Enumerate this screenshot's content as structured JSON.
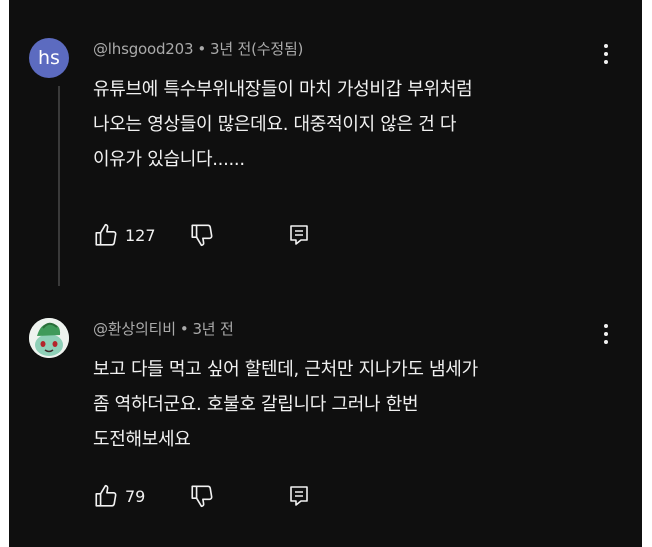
{
  "comments": [
    {
      "avatar_text": "hs",
      "avatar_color": "#5c6bc0",
      "author": "@lhsgood203",
      "separator": "•",
      "time": "3년 전(수정됨)",
      "lines": [
        "유튜브에 특수부위내장들이 마치 가성비갑 부위처럼",
        "나오는 영상들이 많은데요.  대중적이지 않은 건 다",
        "이유가 있습니다......"
      ],
      "likes": "127",
      "icons": [
        "thumb-up-icon",
        "thumb-down-icon",
        "reply-icon",
        "more-vert-icon"
      ]
    },
    {
      "avatar_text": "",
      "author": "@환상의티비",
      "separator": "•",
      "time": "3년 전",
      "lines": [
        "보고 다들 먹고 싶어 할텐데,  근처만 지나가도 냄세가",
        "좀 역하더군요. 호불호 갈립니다 그러나 한번",
        "도전해보세요"
      ],
      "likes": "79",
      "icons": [
        "thumb-up-icon",
        "thumb-down-icon",
        "reply-icon",
        "more-vert-icon"
      ]
    }
  ],
  "colors": {
    "background": "#0f0f0f",
    "text": "#f1f1f1",
    "meta": "#aaaaaa"
  }
}
